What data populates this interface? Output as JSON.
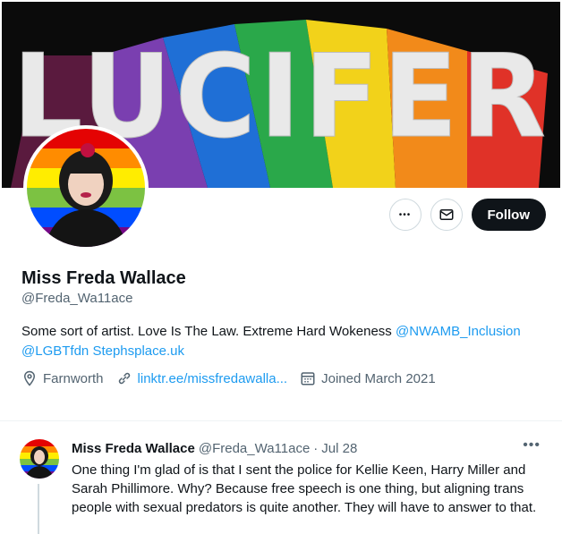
{
  "banner": {
    "text": "LUCIFER"
  },
  "profile": {
    "display_name": "Miss Freda Wallace",
    "handle": "@Freda_Wa11ace",
    "bio_text": "Some sort of artist. Love Is The Law. Extreme Hard Wokeness ",
    "bio_links": [
      "@NWAMB_Inclusion",
      "@LGBTfdn",
      "Stephsplace.uk"
    ],
    "location": "Farnworth",
    "website": "linktr.ee/missfredawalla...",
    "joined": "Joined March 2021"
  },
  "actions": {
    "more_label": "•••",
    "follow_label": "Follow"
  },
  "tweet": {
    "name": "Miss Freda Wallace",
    "handle": "@Freda_Wa11ace",
    "separator": "·",
    "date": "Jul 28",
    "more_label": "•••",
    "text": "One thing I'm glad of is that I sent the police for Kellie Keen, Harry Miller and Sarah Phillimore. Why? Because free speech is one thing, but aligning trans people with sexual predators is quite another. They will have to answer to that."
  },
  "colors": {
    "accent": "#1d9bf0",
    "follow_bg": "#0f1419",
    "secondary_text": "#536471",
    "rainbow": [
      "#e40303",
      "#ff8c00",
      "#ffed00",
      "#008026",
      "#004dff",
      "#750787"
    ]
  },
  "icons": [
    "more-icon",
    "mail-icon",
    "location-icon",
    "link-icon",
    "calendar-icon"
  ]
}
